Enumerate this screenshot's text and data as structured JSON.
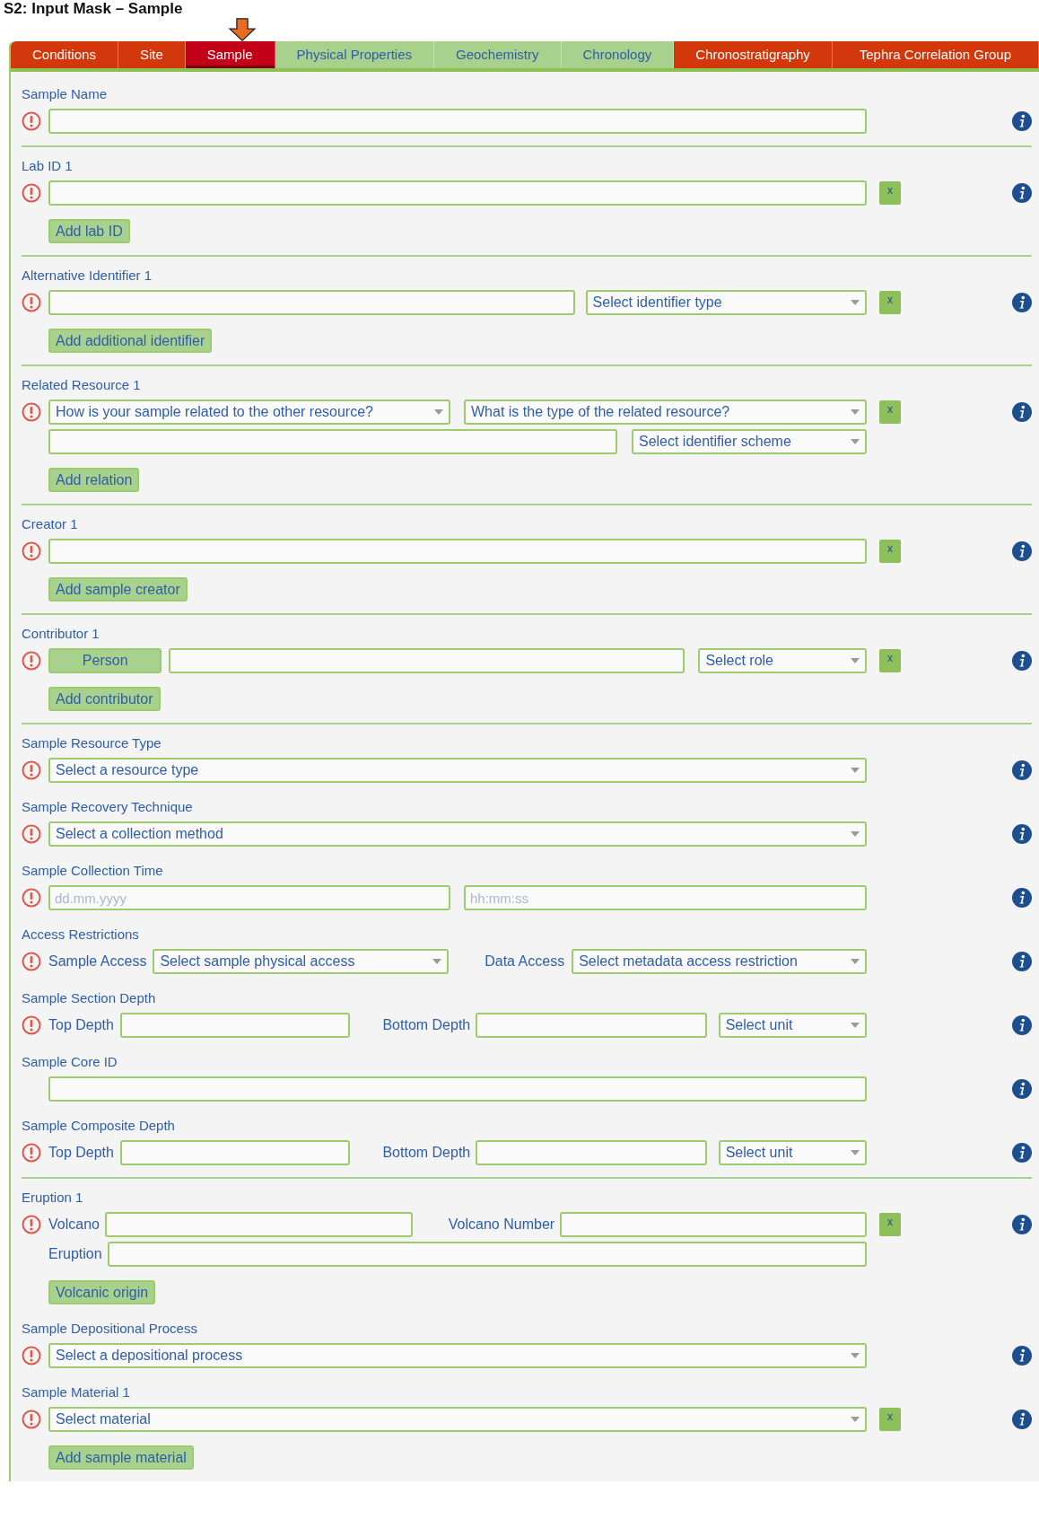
{
  "title": "S2: Input Mask – Sample",
  "tabs": [
    {
      "label": "Conditions",
      "selected": false,
      "color": "#d2380c"
    },
    {
      "label": "Site",
      "selected": false,
      "color": "#d2380c"
    },
    {
      "label": "Sample",
      "selected": true,
      "color": "#c20018"
    },
    {
      "label": "Physical Properties",
      "selected": false,
      "color": "#a9d18e"
    },
    {
      "label": "Geochemistry",
      "selected": false,
      "color": "#a9d18e"
    },
    {
      "label": "Chronology",
      "selected": false,
      "color": "#a9d18e"
    },
    {
      "label": "Chronostratigraphy",
      "selected": false,
      "color": "#d2380c"
    },
    {
      "label": "Tephra Correlation Group",
      "selected": false,
      "color": "#d2380c"
    }
  ],
  "groups": [
    [
      {
        "label": "Sample Name",
        "required": true,
        "rows": [
          [
            {
              "kind": "text"
            }
          ]
        ]
      }
    ],
    [
      {
        "label": "Lab ID 1",
        "required": true,
        "remove": "x",
        "rows": [
          [
            {
              "kind": "text"
            }
          ]
        ],
        "add_button": "Add lab ID"
      }
    ],
    [
      {
        "label": "Alternative Identifier 1",
        "required": true,
        "remove": "x",
        "rows": [
          [
            {
              "kind": "text"
            },
            {
              "kind": "select",
              "prompt": "Select identifier type"
            }
          ]
        ],
        "add_button": "Add additional identifier"
      }
    ],
    [
      {
        "label": "Related Resource 1",
        "required": true,
        "remove": "x",
        "rows": [
          [
            {
              "kind": "select",
              "prompt": "How is your sample related to the other resource?"
            },
            {
              "kind": "select",
              "prompt": "What is the type of the related resource?"
            }
          ],
          [
            {
              "kind": "text"
            },
            {
              "kind": "select",
              "prompt": "Select identifier scheme"
            }
          ]
        ],
        "add_button": "Add relation"
      }
    ],
    [
      {
        "label": "Creator 1",
        "required": true,
        "remove": "x",
        "rows": [
          [
            {
              "kind": "text"
            }
          ]
        ],
        "add_button": "Add sample creator"
      }
    ],
    [
      {
        "label": "Contributor 1",
        "required": true,
        "remove": "x",
        "rows": [
          [
            {
              "kind": "toggle",
              "text": "Person"
            },
            {
              "kind": "text"
            },
            {
              "kind": "select",
              "prompt": "Select role"
            }
          ]
        ],
        "add_button": "Add contributor"
      }
    ],
    [
      {
        "label": "Sample Resource Type",
        "required": true,
        "rows": [
          [
            {
              "kind": "select",
              "prompt": "Select a resource type"
            }
          ]
        ]
      },
      {
        "label": "Sample Recovery Technique",
        "required": true,
        "rows": [
          [
            {
              "kind": "select",
              "prompt": "Select a collection method"
            }
          ]
        ]
      },
      {
        "label": "Sample Collection Time",
        "required": true,
        "rows": [
          [
            {
              "kind": "text",
              "placeholder": "dd.mm.yyyy"
            },
            {
              "kind": "text",
              "placeholder": "hh:mm:ss"
            }
          ]
        ]
      },
      {
        "label": "Access Restrictions",
        "required": true,
        "rows": [
          [
            {
              "kind": "label",
              "text": "Sample Access"
            },
            {
              "kind": "select",
              "prompt": "Select sample physical access"
            },
            {
              "kind": "label",
              "text": "Data Access"
            },
            {
              "kind": "select",
              "prompt": "Select metadata access restriction"
            }
          ]
        ]
      },
      {
        "label": "Sample Section Depth",
        "required": true,
        "rows": [
          [
            {
              "kind": "label",
              "text": "Top Depth"
            },
            {
              "kind": "text"
            },
            {
              "kind": "label",
              "text": "Bottom Depth"
            },
            {
              "kind": "text"
            },
            {
              "kind": "select",
              "prompt": "Select unit"
            }
          ]
        ]
      },
      {
        "label": "Sample Core ID",
        "required": false,
        "rows": [
          [
            {
              "kind": "text"
            }
          ]
        ]
      },
      {
        "label": "Sample Composite Depth",
        "required": true,
        "rows": [
          [
            {
              "kind": "label",
              "text": "Top Depth"
            },
            {
              "kind": "text"
            },
            {
              "kind": "label",
              "text": "Bottom Depth"
            },
            {
              "kind": "text"
            },
            {
              "kind": "select",
              "prompt": "Select unit"
            }
          ]
        ]
      }
    ],
    [
      {
        "label": "Eruption 1",
        "required": true,
        "remove": "x",
        "rows": [
          [
            {
              "kind": "label",
              "text": "Volcano"
            },
            {
              "kind": "text"
            },
            {
              "kind": "label",
              "text": "Volcano Number"
            },
            {
              "kind": "text"
            }
          ],
          [
            {
              "kind": "label",
              "text": "Eruption"
            },
            {
              "kind": "text"
            }
          ]
        ],
        "add_button": "Volcanic origin"
      },
      {
        "label": "Sample Depositional Process",
        "required": true,
        "rows": [
          [
            {
              "kind": "select",
              "prompt": "Select a depositional process"
            }
          ]
        ]
      },
      {
        "label": "Sample Material 1",
        "required": true,
        "remove": "x",
        "rows": [
          [
            {
              "kind": "select",
              "prompt": "Select material"
            }
          ]
        ],
        "add_button": "Add sample material"
      }
    ]
  ]
}
